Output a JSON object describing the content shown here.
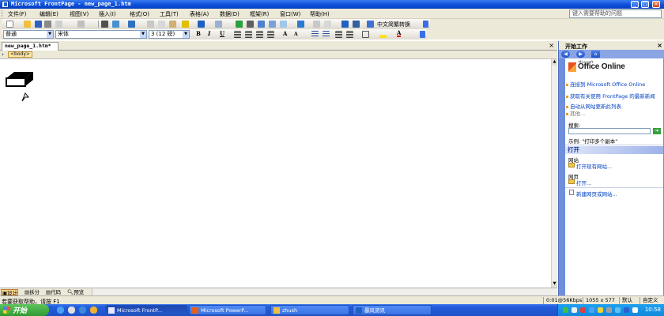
{
  "window": {
    "title": "Microsoft FrontPage - new_page_1.htm"
  },
  "menu": {
    "items": [
      "文件(F)",
      "编辑(E)",
      "视图(V)",
      "插入(I)",
      "格式(O)",
      "工具(T)",
      "表格(A)",
      "数据(D)",
      "框架(R)",
      "窗口(W)",
      "帮助(H)"
    ],
    "help_search_placeholder": "键入需要帮助的问题"
  },
  "toolbar": {
    "chinese_convert_label": "中文简繁转换",
    "style_value": "普通",
    "font_value": "宋体",
    "size_value": "3 (12 磅)"
  },
  "document": {
    "tab_label": "new_page_1.htm*",
    "quick_tag": "<body>",
    "close_glyph": "×"
  },
  "view_tabs": [
    "设计",
    "拆分",
    "代码",
    "预览"
  ],
  "task_pane": {
    "title": "开始工作",
    "logo_text": "Office Online",
    "logo_ms": "Microsoft",
    "links": [
      "连接到 Microsoft Office Online",
      "获取有关使用 FrontPage 的最新新闻",
      "自动从网站更新此列表"
    ],
    "more_link": "其他...",
    "search_label": "搜索:",
    "example_text": "示例:  \"打印多个副本\"",
    "open_section": "打开",
    "site_label": "网站",
    "open_site_link": "打开现有网站...",
    "page_label": "网页",
    "open_link": "打开...",
    "new_site_link": "新建网页或网站..."
  },
  "status": {
    "message": "若要获取帮助，请按 F1",
    "speed": "0:01@56Kbps",
    "dimensions": "1055 x 577",
    "mode": "默认",
    "custom": "自定义"
  },
  "taskbar": {
    "start_label": "开始",
    "tasks": [
      "Microsoft FrontP...",
      "Microsoft PowerP...",
      "zhush",
      "暴风资讯"
    ],
    "clock": "10:58"
  }
}
